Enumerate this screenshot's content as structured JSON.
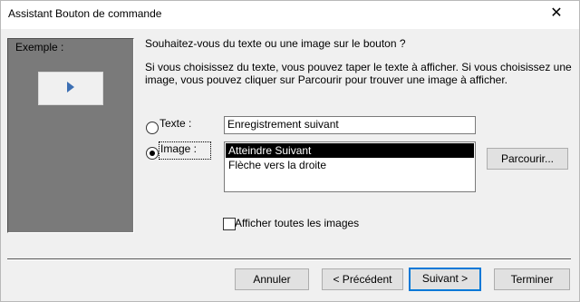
{
  "window": {
    "title": "Assistant Bouton de commande",
    "close_glyph": "✕"
  },
  "sample": {
    "label": "Exemple :",
    "icon": "play-arrow-icon"
  },
  "content": {
    "question": "Souhaitez-vous du texte ou une image sur le bouton ?",
    "description_line1": "Si vous choisissez du texte, vous pouvez taper le texte à afficher. Si vous choisissez une",
    "description_line2": "image, vous pouvez cliquer sur Parcourir pour trouver une image à afficher."
  },
  "options": {
    "text_option": {
      "label": "Texte :",
      "selected": false
    },
    "image_option": {
      "label": "Image :",
      "selected": true
    },
    "text_value": "Enregistrement suivant",
    "image_list": [
      {
        "label": "Atteindre Suivant",
        "selected": true
      },
      {
        "label": "Flèche vers la droite",
        "selected": false
      }
    ],
    "browse_label": "Parcourir...",
    "show_all_label": "Afficher toutes les images",
    "show_all_checked": false
  },
  "footer": {
    "cancel_label": "Annuler",
    "previous_label": "< Précédent",
    "next_label": "Suivant >",
    "finish_label": "Terminer"
  },
  "colors": {
    "accent": "#0078d7",
    "panel": "#7a7a7a",
    "arrow": "#3c6fb3"
  }
}
